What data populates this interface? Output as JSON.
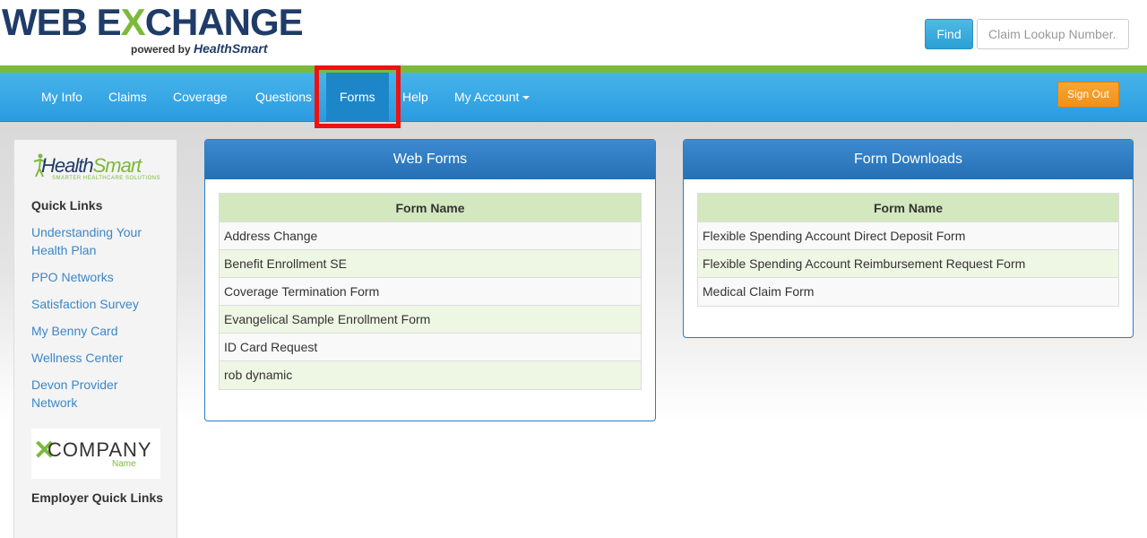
{
  "header": {
    "logo_web": "WEB E",
    "logo_x": "X",
    "logo_change": "CHANGE",
    "powered_by": "powered by",
    "brand": "HealthSmart",
    "find_label": "Find",
    "claim_placeholder": "Claim Lookup Number.."
  },
  "nav": {
    "items": [
      {
        "label": "My Info"
      },
      {
        "label": "Claims"
      },
      {
        "label": "Coverage"
      },
      {
        "label": "Questions"
      },
      {
        "label": "Forms",
        "active": true
      },
      {
        "label": "Help"
      },
      {
        "label": "My Account"
      }
    ],
    "signout_label": "Sign Out"
  },
  "sidebar": {
    "hs_logo_health": "Health",
    "hs_logo_smart": "Smart",
    "hs_logo_tagline": "SMARTER HEALTHCARE SOLUTIONS",
    "quick_links_heading": "Quick Links",
    "links": [
      {
        "label": "Understanding Your Health Plan"
      },
      {
        "label": "PPO Networks"
      },
      {
        "label": "Satisfaction Survey"
      },
      {
        "label": "My Benny Card"
      },
      {
        "label": "Wellness Center"
      },
      {
        "label": "Devon Provider Network"
      }
    ],
    "company_logo_word": "COMPANY",
    "company_logo_name": "Name",
    "employer_heading": "Employer Quick Links"
  },
  "web_forms": {
    "title": "Web Forms",
    "column": "Form Name",
    "rows": [
      "Address Change",
      "Benefit Enrollment SE",
      "Coverage Termination Form",
      "Evangelical Sample Enrollment Form",
      "ID Card Request",
      "rob dynamic"
    ]
  },
  "form_downloads": {
    "title": "Form Downloads",
    "column": "Form Name",
    "rows": [
      "Flexible Spending Account Direct Deposit Form",
      "Flexible Spending Account Reimbursement Request Form",
      "Medical Claim Form"
    ]
  },
  "colors": {
    "brand_navy": "#1f3c68",
    "brand_green": "#7cb93a",
    "nav_blue": "#2b9be0",
    "signout_orange": "#f0901a",
    "highlight_red": "#ee1111"
  }
}
